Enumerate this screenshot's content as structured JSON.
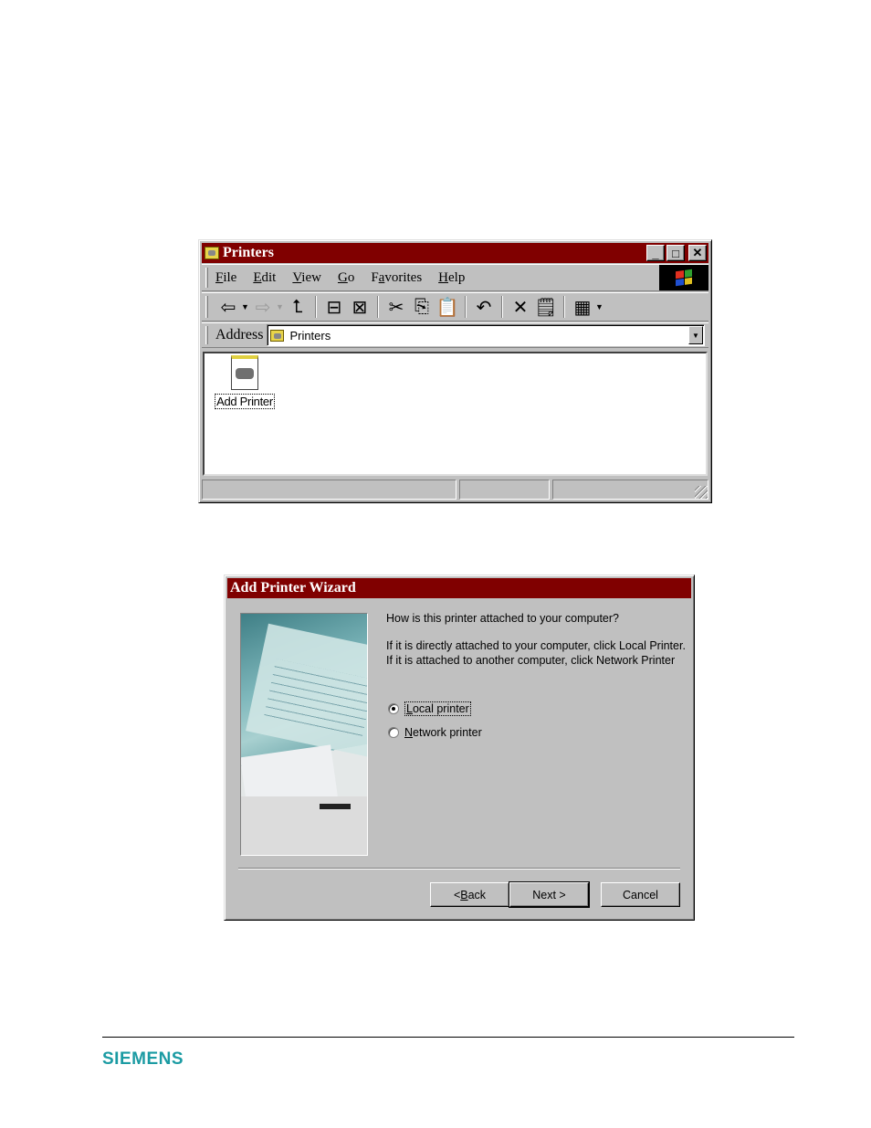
{
  "explorer": {
    "title": "Printers",
    "caption_buttons": {
      "minimize": "_",
      "maximize": "□",
      "close": "✕"
    },
    "menu": [
      {
        "label_u": "F",
        "label_rest": "ile"
      },
      {
        "label_u": "E",
        "label_rest": "dit"
      },
      {
        "label_u": "V",
        "label_rest": "iew"
      },
      {
        "label_u": "G",
        "label_rest": "o"
      },
      {
        "label_pre": "F",
        "label_u": "a",
        "label_rest": "vorites"
      },
      {
        "label_u": "H",
        "label_rest": "elp"
      }
    ],
    "toolbar": {
      "back": "⇦",
      "back_dropdown": "▼",
      "forward": "⇨",
      "forward_dropdown": "▼",
      "up": "⮤",
      "map_drive": "⊟",
      "disconnect": "⊠",
      "cut": "✂",
      "copy": "⎘",
      "paste": "📋",
      "undo": "↶",
      "delete": "✕",
      "properties": "🗒",
      "views": "▦",
      "views_dropdown": "▼"
    },
    "address": {
      "label": "Address",
      "value": "Printers"
    },
    "items": [
      {
        "label": "Add Printer",
        "icon": "add-printer-icon"
      }
    ],
    "status_panes": [
      "",
      "",
      ""
    ]
  },
  "wizard": {
    "title": "Add Printer Wizard",
    "question": "How is this printer attached to your computer?",
    "description": "If it is directly attached to your computer, click Local Printer. If it is attached to another computer, click Network Printer",
    "options": [
      {
        "label_u": "L",
        "label_rest": "ocal printer",
        "checked": true
      },
      {
        "label_u": "N",
        "label_rest": "etwork printer",
        "checked": false
      }
    ],
    "buttons": {
      "back_pre": "< ",
      "back_u": "B",
      "back_rest": "ack",
      "next": "Next >",
      "cancel": "Cancel"
    }
  },
  "footer": {
    "logo": "SIEMENS"
  }
}
